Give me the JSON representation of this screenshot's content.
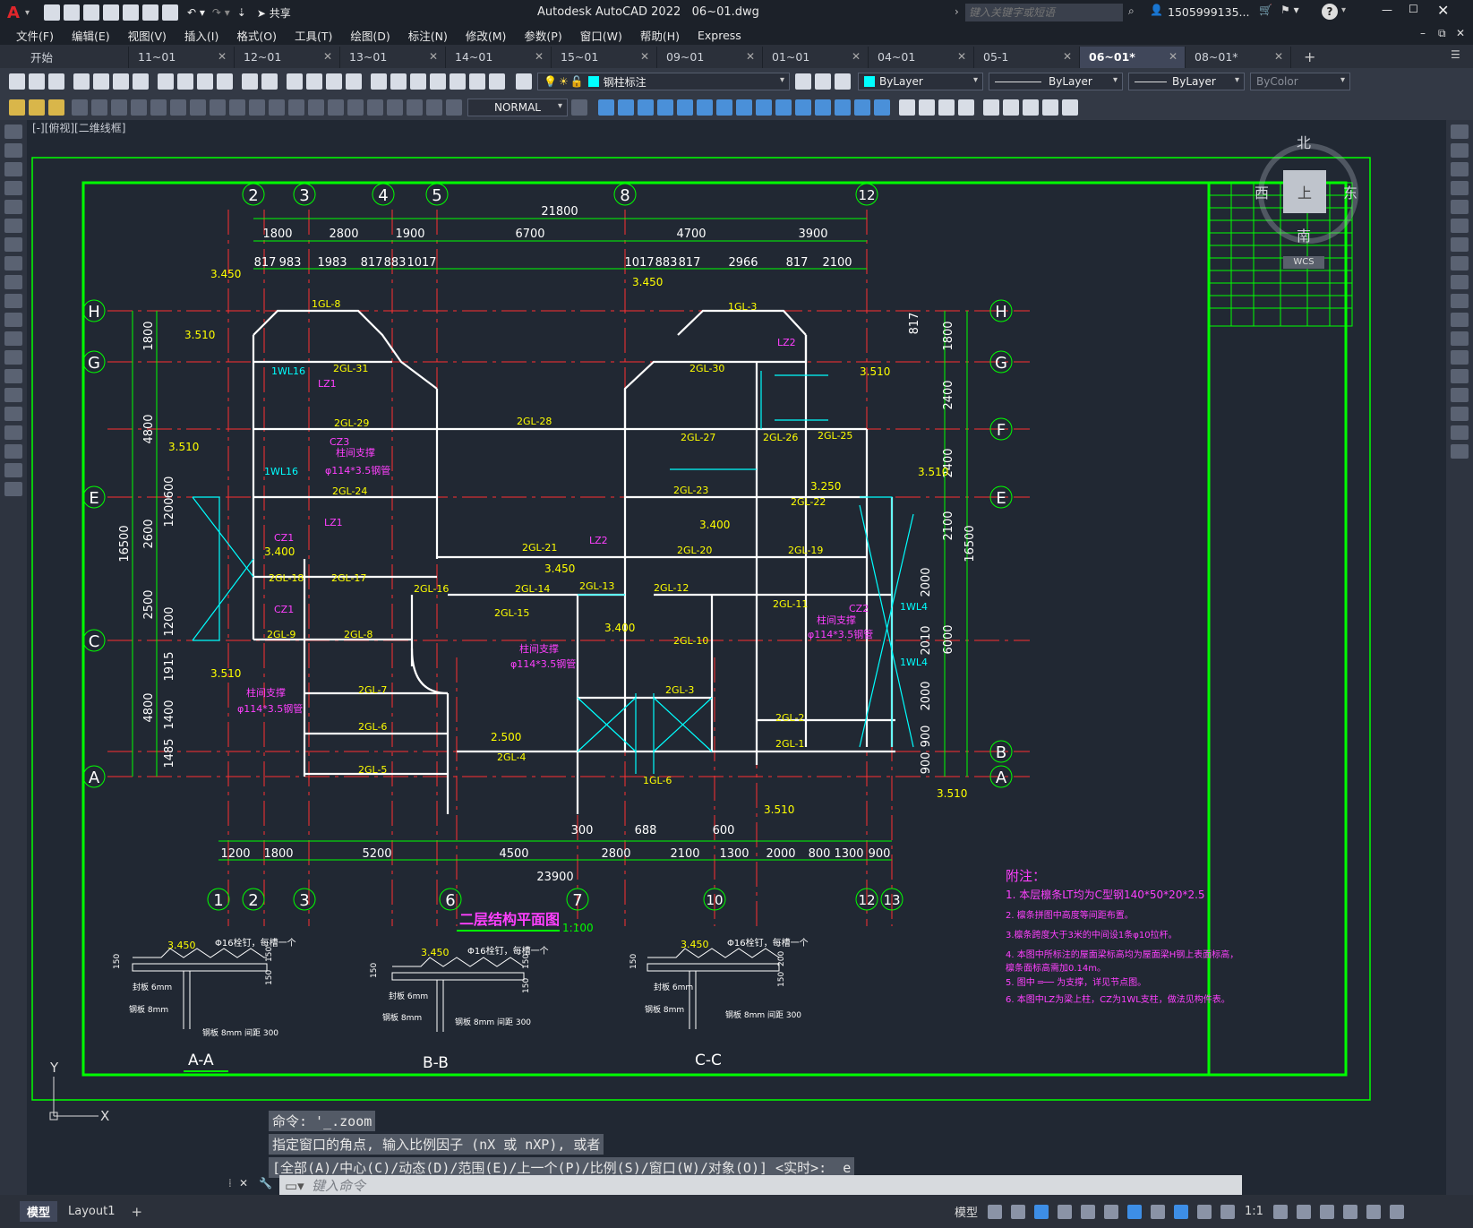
{
  "app": {
    "title": "Autodesk AutoCAD 2022",
    "file": "06~01.dwg",
    "search_placeholder": "键入关键字或短语",
    "user": "1505999135...",
    "share": "共享"
  },
  "menu": [
    "文件(F)",
    "编辑(E)",
    "视图(V)",
    "插入(I)",
    "格式(O)",
    "工具(T)",
    "绘图(D)",
    "标注(N)",
    "修改(M)",
    "参数(P)",
    "窗口(W)",
    "帮助(H)",
    "Express"
  ],
  "tabs": [
    {
      "label": "开始",
      "active": false
    },
    {
      "label": "11~01",
      "active": false
    },
    {
      "label": "12~01",
      "active": false
    },
    {
      "label": "13~01",
      "active": false
    },
    {
      "label": "14~01",
      "active": false
    },
    {
      "label": "15~01",
      "active": false
    },
    {
      "label": "09~01",
      "active": false
    },
    {
      "label": "01~01",
      "active": false
    },
    {
      "label": "04~01",
      "active": false
    },
    {
      "label": "05-1",
      "active": false
    },
    {
      "label": "06~01*",
      "active": true
    },
    {
      "label": "08~01*",
      "active": false
    }
  ],
  "toolbar": {
    "layer_name": "钢柱标注",
    "color": "ByLayer",
    "linetype": "ByLayer",
    "lineweight": "ByLayer",
    "plotstyle": "ByColor",
    "dimstyle": "NORMAL"
  },
  "viewport_label": "[-][俯视][二维线框]",
  "viewcube": {
    "north": "北",
    "south": "南",
    "east": "东",
    "west": "西",
    "top": "上",
    "wcs": "WCS"
  },
  "drawing": {
    "title": "二层结构平面图",
    "scale": "1:100",
    "sections": [
      "A-A",
      "B-B",
      "C-C"
    ],
    "axes_top": [
      "2",
      "3",
      "4",
      "5",
      "8",
      "12"
    ],
    "axes_bottom": [
      "1",
      "2",
      "3",
      "6",
      "7",
      "10",
      "12",
      "13"
    ],
    "axes_left": [
      "H",
      "G",
      "E",
      "C",
      "A"
    ],
    "axes_right": [
      "H",
      "G",
      "F",
      "E",
      "B",
      "A"
    ],
    "dims_top_total": "21800",
    "dims_top_row1": [
      "1800",
      "2800",
      "1900",
      "6700",
      "4700",
      "3900"
    ],
    "dims_top_row2": [
      "817",
      "983",
      "1983",
      "817",
      "883",
      "1017",
      "1017",
      "883",
      "817",
      "2966",
      "817",
      "2100"
    ],
    "dims_bottom_total": "23900",
    "dims_bottom_row": [
      "1200",
      "1800",
      "5200",
      "4500",
      "2800",
      "2100",
      "1300",
      "2000",
      "800",
      "1300",
      "900"
    ],
    "dims_bottom_small": [
      "300",
      "688",
      "600"
    ],
    "dims_left": [
      "1800",
      "4800",
      "2600",
      "2500",
      "4800",
      "1485",
      "1400",
      "1915",
      "1200",
      "1200",
      "600",
      "16500"
    ],
    "dims_right": [
      "817",
      "1800",
      "2400",
      "2400",
      "2100",
      "2000",
      "2010",
      "2000",
      "900",
      "900",
      "6000",
      "16500"
    ],
    "elev": [
      "3.450",
      "3.510",
      "3.510",
      "3.510",
      "3.450",
      "3.510",
      "3.510",
      "3.250",
      "3.400",
      "3.400",
      "3.400",
      "3.450",
      "2.500",
      "3.510"
    ],
    "beams": [
      "1GL-8",
      "1GL-3",
      "2GL-31",
      "2GL-30",
      "2GL-29",
      "2GL-28",
      "2GL-27",
      "2GL-26",
      "2GL-25",
      "2GL-24",
      "2GL-23",
      "2GL-22",
      "2GL-21",
      "2GL-20",
      "2GL-19",
      "2GL-18",
      "2GL-17",
      "2GL-16",
      "2GL-15",
      "2GL-14",
      "2GL-13",
      "2GL-12",
      "2GL-11",
      "2GL-10",
      "2GL-9",
      "2GL-8",
      "2GL-7",
      "2GL-6",
      "2GL-5",
      "2GL-4",
      "2GL-3",
      "2GL-2",
      "2GL-1",
      "1GL-6",
      "1WL16",
      "1WL16",
      "1WL4",
      "1WL4",
      "CZ3",
      "CZ1",
      "CZ1",
      "LZ1",
      "LZ1",
      "LZ2",
      "LZ2",
      "CZ2"
    ],
    "notes_title": "附注：",
    "notes": [
      "1. 本层檩条LT均为C型钢140*50*20*2.5",
      "2. 檩条拼图中高度等间距布置。",
      "3.檩条跨度大于3米的中间设1条φ10拉杆。",
      "4. 本图中所标注的屋面梁标高均为屋面梁H钢上表面标高，",
      "   檩条面标高需加0.14m。",
      "5. 图中 ═── 为支撑，详见节点图。",
      "6. 本图中LZ为梁上柱，CZ为1WL支柱，做法见构件表。"
    ],
    "section_labels": {
      "bolt": "Φ16栓钉，每槽一个",
      "plate6": "封板 6mm",
      "plate8": "钢板 8mm",
      "spacing": "钢板 8mm 间距 300",
      "elev": "3.450",
      "dim150": "150",
      "dim200": "200"
    },
    "brace": "柱间支撑",
    "brace_size": "φ114*3.5钢管"
  },
  "command": {
    "line1": "命令: '_.zoom",
    "line2": "指定窗口的角点, 输入比例因子 (nX 或 nXP), 或者",
    "line3": "[全部(A)/中心(C)/动态(D)/范围(E)/上一个(P)/比例(S)/窗口(W)/对象(O)] <实时>: _e",
    "placeholder": "键入命令"
  },
  "status": {
    "model_tab": "模型",
    "layout_tab": "Layout1",
    "mode": "模型",
    "scale": "1:1"
  },
  "ucs": {
    "y": "Y",
    "x": "X"
  },
  "colors": {
    "green": "#00ff00",
    "yellow": "#ffff00",
    "cyan": "#00ffff",
    "magenta": "#ff00ff",
    "red": "#ff0000",
    "white": "#ffffff"
  }
}
